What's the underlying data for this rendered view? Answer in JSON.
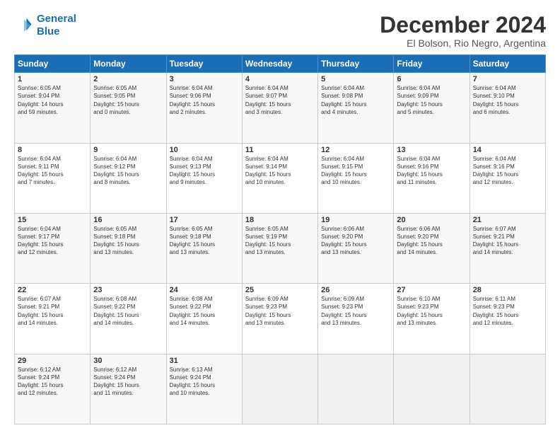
{
  "header": {
    "logo_line1": "General",
    "logo_line2": "Blue",
    "month": "December 2024",
    "location": "El Bolson, Rio Negro, Argentina"
  },
  "weekdays": [
    "Sunday",
    "Monday",
    "Tuesday",
    "Wednesday",
    "Thursday",
    "Friday",
    "Saturday"
  ],
  "weeks": [
    [
      {
        "day": "1",
        "info": "Sunrise: 6:05 AM\nSunset: 9:04 PM\nDaylight: 14 hours\nand 59 minutes."
      },
      {
        "day": "2",
        "info": "Sunrise: 6:05 AM\nSunset: 9:05 PM\nDaylight: 15 hours\nand 0 minutes."
      },
      {
        "day": "3",
        "info": "Sunrise: 6:04 AM\nSunset: 9:06 PM\nDaylight: 15 hours\nand 2 minutes."
      },
      {
        "day": "4",
        "info": "Sunrise: 6:04 AM\nSunset: 9:07 PM\nDaylight: 15 hours\nand 3 minutes."
      },
      {
        "day": "5",
        "info": "Sunrise: 6:04 AM\nSunset: 9:08 PM\nDaylight: 15 hours\nand 4 minutes."
      },
      {
        "day": "6",
        "info": "Sunrise: 6:04 AM\nSunset: 9:09 PM\nDaylight: 15 hours\nand 5 minutes."
      },
      {
        "day": "7",
        "info": "Sunrise: 6:04 AM\nSunset: 9:10 PM\nDaylight: 15 hours\nand 6 minutes."
      }
    ],
    [
      {
        "day": "8",
        "info": "Sunrise: 6:04 AM\nSunset: 9:11 PM\nDaylight: 15 hours\nand 7 minutes."
      },
      {
        "day": "9",
        "info": "Sunrise: 6:04 AM\nSunset: 9:12 PM\nDaylight: 15 hours\nand 8 minutes."
      },
      {
        "day": "10",
        "info": "Sunrise: 6:04 AM\nSunset: 9:13 PM\nDaylight: 15 hours\nand 9 minutes."
      },
      {
        "day": "11",
        "info": "Sunrise: 6:04 AM\nSunset: 9:14 PM\nDaylight: 15 hours\nand 10 minutes."
      },
      {
        "day": "12",
        "info": "Sunrise: 6:04 AM\nSunset: 9:15 PM\nDaylight: 15 hours\nand 10 minutes."
      },
      {
        "day": "13",
        "info": "Sunrise: 6:04 AM\nSunset: 9:16 PM\nDaylight: 15 hours\nand 11 minutes."
      },
      {
        "day": "14",
        "info": "Sunrise: 6:04 AM\nSunset: 9:16 PM\nDaylight: 15 hours\nand 12 minutes."
      }
    ],
    [
      {
        "day": "15",
        "info": "Sunrise: 6:04 AM\nSunset: 9:17 PM\nDaylight: 15 hours\nand 12 minutes."
      },
      {
        "day": "16",
        "info": "Sunrise: 6:05 AM\nSunset: 9:18 PM\nDaylight: 15 hours\nand 13 minutes."
      },
      {
        "day": "17",
        "info": "Sunrise: 6:05 AM\nSunset: 9:18 PM\nDaylight: 15 hours\nand 13 minutes."
      },
      {
        "day": "18",
        "info": "Sunrise: 6:05 AM\nSunset: 9:19 PM\nDaylight: 15 hours\nand 13 minutes."
      },
      {
        "day": "19",
        "info": "Sunrise: 6:06 AM\nSunset: 9:20 PM\nDaylight: 15 hours\nand 13 minutes."
      },
      {
        "day": "20",
        "info": "Sunrise: 6:06 AM\nSunset: 9:20 PM\nDaylight: 15 hours\nand 14 minutes."
      },
      {
        "day": "21",
        "info": "Sunrise: 6:07 AM\nSunset: 9:21 PM\nDaylight: 15 hours\nand 14 minutes."
      }
    ],
    [
      {
        "day": "22",
        "info": "Sunrise: 6:07 AM\nSunset: 9:21 PM\nDaylight: 15 hours\nand 14 minutes."
      },
      {
        "day": "23",
        "info": "Sunrise: 6:08 AM\nSunset: 9:22 PM\nDaylight: 15 hours\nand 14 minutes."
      },
      {
        "day": "24",
        "info": "Sunrise: 6:08 AM\nSunset: 9:22 PM\nDaylight: 15 hours\nand 14 minutes."
      },
      {
        "day": "25",
        "info": "Sunrise: 6:09 AM\nSunset: 9:23 PM\nDaylight: 15 hours\nand 13 minutes."
      },
      {
        "day": "26",
        "info": "Sunrise: 6:09 AM\nSunset: 9:23 PM\nDaylight: 15 hours\nand 13 minutes."
      },
      {
        "day": "27",
        "info": "Sunrise: 6:10 AM\nSunset: 9:23 PM\nDaylight: 15 hours\nand 13 minutes."
      },
      {
        "day": "28",
        "info": "Sunrise: 6:11 AM\nSunset: 9:23 PM\nDaylight: 15 hours\nand 12 minutes."
      }
    ],
    [
      {
        "day": "29",
        "info": "Sunrise: 6:12 AM\nSunset: 9:24 PM\nDaylight: 15 hours\nand 12 minutes."
      },
      {
        "day": "30",
        "info": "Sunrise: 6:12 AM\nSunset: 9:24 PM\nDaylight: 15 hours\nand 11 minutes."
      },
      {
        "day": "31",
        "info": "Sunrise: 6:13 AM\nSunset: 9:24 PM\nDaylight: 15 hours\nand 10 minutes."
      },
      {
        "day": "",
        "info": ""
      },
      {
        "day": "",
        "info": ""
      },
      {
        "day": "",
        "info": ""
      },
      {
        "day": "",
        "info": ""
      }
    ]
  ]
}
